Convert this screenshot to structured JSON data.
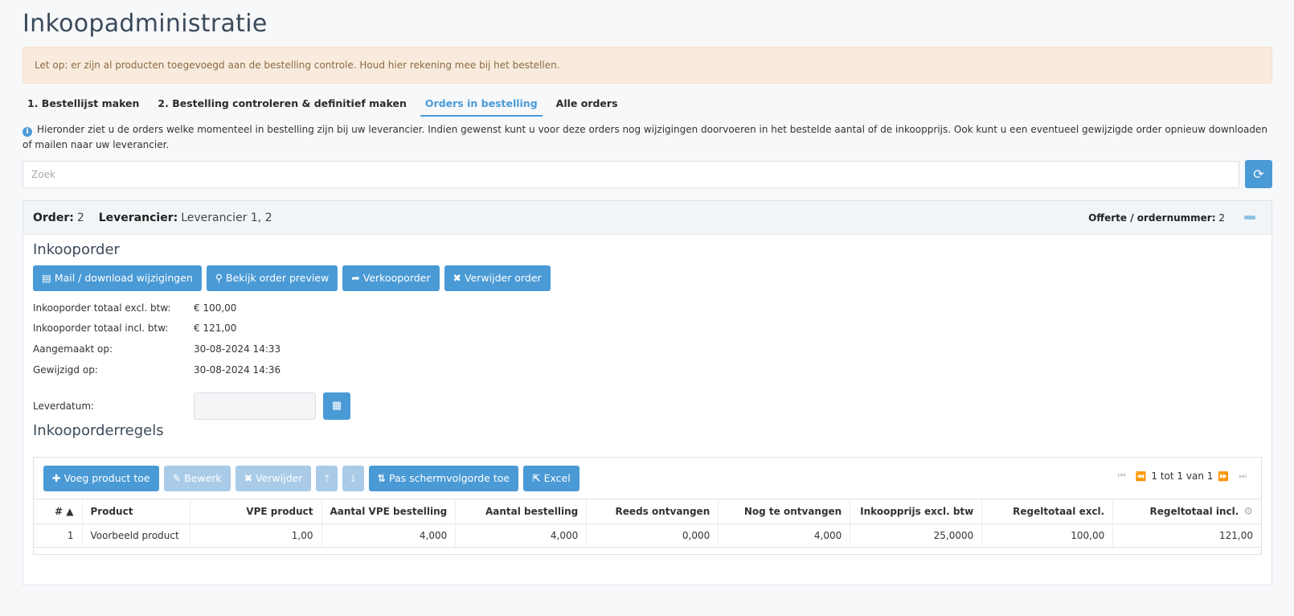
{
  "page_title": "Inkoopadministratie",
  "alert_text": "Let op: er zijn al producten toegevoegd aan de bestelling controle. Houd hier rekening mee bij het bestellen.",
  "tabs": [
    {
      "label": "1. Bestellijst maken"
    },
    {
      "label": "2. Bestelling controleren & definitief maken"
    },
    {
      "label": "Orders in bestelling",
      "active": true
    },
    {
      "label": "Alle orders"
    }
  ],
  "info_text": "Hieronder ziet u de orders welke momenteel in bestelling zijn bij uw leverancier. Indien gewenst kunt u voor deze orders nog wijzigingen doorvoeren in het bestelde aantal of de inkoopprijs. Ook kunt u een eventueel gewijzigde order opnieuw downloaden of mailen naar uw leverancier.",
  "search": {
    "placeholder": "Zoek"
  },
  "order": {
    "order_label": "Order:",
    "order_value": "2",
    "supplier_label": "Leverancier:",
    "supplier_value": "Leverancier 1, 2",
    "quote_label": "Offerte / ordernummer:",
    "quote_value": "2"
  },
  "purchase_order": {
    "title": "Inkooporder",
    "buttons": {
      "mail": "Mail / download wijzigingen",
      "preview": "Bekijk order preview",
      "sales": "Verkooporder",
      "delete": "Verwijder order"
    },
    "fields": [
      {
        "label": "Inkooporder totaal excl. btw:",
        "value": "€ 100,00"
      },
      {
        "label": "Inkooporder totaal incl. btw:",
        "value": "€ 121,00"
      },
      {
        "label": "Aangemaakt op:",
        "value": "30-08-2024 14:33"
      },
      {
        "label": "Gewijzigd op:",
        "value": "30-08-2024 14:36"
      }
    ],
    "delivery_label": "Leverdatum:"
  },
  "lines": {
    "title": "Inkooporderregels",
    "toolbar": {
      "add": "Voeg product toe",
      "edit": "Bewerk",
      "delete": "Verwijder",
      "apply_order": "Pas schermvolgorde toe",
      "excel": "Excel"
    },
    "pager_text": "1 tot 1 van 1",
    "columns": [
      "# ▲",
      "Product",
      "VPE product",
      "Aantal VPE bestelling",
      "Aantal bestelling",
      "Reeds ontvangen",
      "Nog te ontvangen",
      "Inkoopprijs excl. btw",
      "Regeltotaal excl.",
      "Regeltotaal incl."
    ],
    "rows": [
      [
        "1",
        "Voorbeeld product",
        "1,00",
        "4,000",
        "4,000",
        "0,000",
        "4,000",
        "25,0000",
        "100,00",
        "121,00"
      ]
    ]
  },
  "colors": {
    "accent": "#4a9ad6",
    "alert_bg": "#f8ebdd"
  }
}
